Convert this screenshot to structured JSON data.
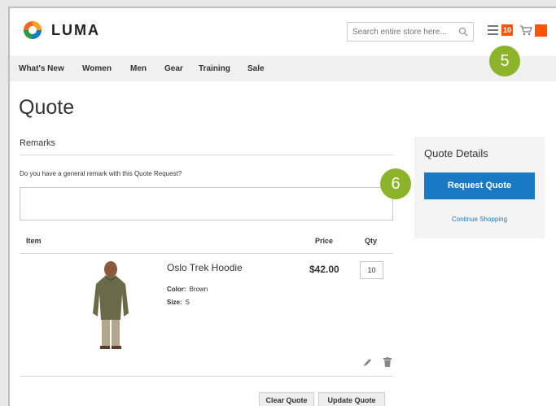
{
  "header": {
    "brand": "LUMA",
    "search_placeholder": "Search entire store here...",
    "quote_count": "10"
  },
  "nav": {
    "items": [
      "What's New",
      "Women",
      "Men",
      "Gear",
      "Training",
      "Sale"
    ]
  },
  "page": {
    "title": "Quote"
  },
  "remarks": {
    "title": "Remarks",
    "question": "Do you have a general remark with this Quote Request?",
    "value": ""
  },
  "table": {
    "columns": {
      "item": "Item",
      "price": "Price",
      "qty": "Qty"
    },
    "rows": [
      {
        "name": "Oslo Trek Hoodie",
        "color_label": "Color:",
        "color_value": "Brown",
        "size_label": "Size:",
        "size_value": "S",
        "price": "$42.00",
        "qty": "10"
      }
    ]
  },
  "actions": {
    "clear": "Clear Quote",
    "update": "Update Quote"
  },
  "sidebar": {
    "title": "Quote Details",
    "request_button": "Request Quote",
    "continue_link": "Continue Shopping"
  },
  "annotations": {
    "step5": "5",
    "step6": "6"
  },
  "colors": {
    "accent": "#ff5501",
    "primary": "#1979c3",
    "step_marker": "#8bb42b"
  }
}
